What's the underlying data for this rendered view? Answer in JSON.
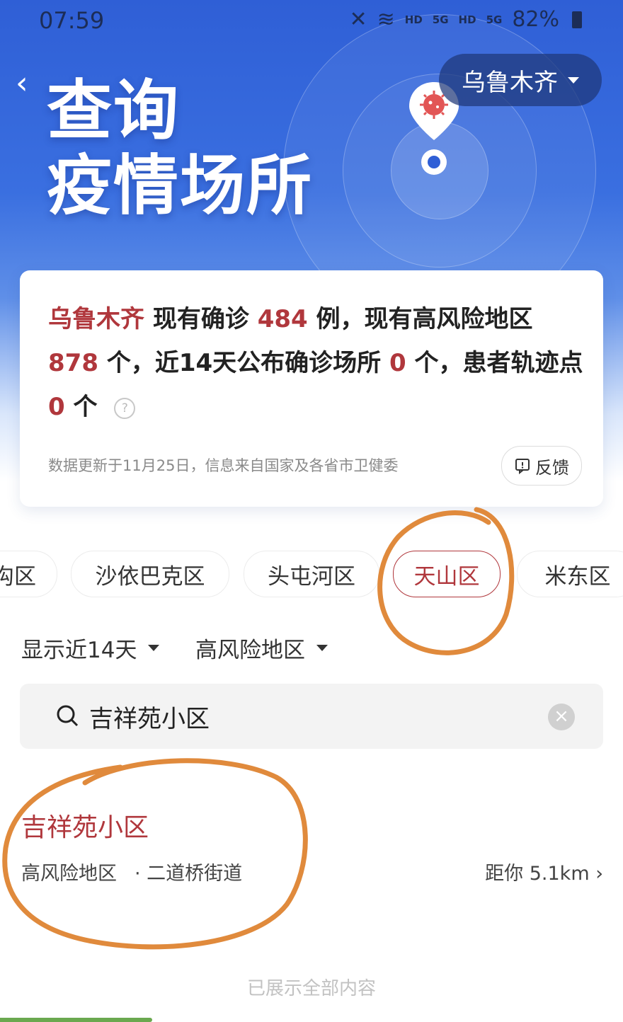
{
  "status_bar": {
    "time": "07:59",
    "battery": "82%",
    "net1": "HD",
    "net2": "5G",
    "net3": "HD",
    "net4": "5G"
  },
  "header": {
    "back_label": "‹",
    "title_line1": "查询",
    "title_line2": "疫情场所",
    "city": "乌鲁木齐"
  },
  "summary": {
    "city": "乌鲁木齐",
    "text1": "现有确诊",
    "confirmed": "484",
    "text2": "例，现有高风险地区",
    "high_risk_areas": "878",
    "text3": "个，近14天公布确诊场所",
    "places": "0",
    "text4": "个，患者轨迹点",
    "track_points": "0",
    "text5": "个",
    "help_symbol": "?",
    "update_note": "数据更新于11月25日，信息来自国家及各省市卫健委",
    "feedback_label": "反馈"
  },
  "district_tabs": [
    {
      "label": "沟区",
      "active": false
    },
    {
      "label": "沙依巴克区",
      "active": false
    },
    {
      "label": "头屯河区",
      "active": false
    },
    {
      "label": "天山区",
      "active": true
    },
    {
      "label": "米东区",
      "active": false
    }
  ],
  "filters": {
    "time_range": "显示近14天",
    "risk_level": "高风险地区"
  },
  "search": {
    "query": "吉祥苑小区",
    "clear_symbol": "×"
  },
  "results": [
    {
      "name": "吉祥苑小区",
      "risk": "高风险地区",
      "street": "· 二道桥街道",
      "distance": "距你 5.1km ›"
    }
  ],
  "footer": {
    "end_note": "已展示全部内容"
  },
  "colors": {
    "accent_red": "#b0373c",
    "hero_blue": "#2f5fd6",
    "annotation_orange": "#e08a3c"
  },
  "icons": [
    "back-icon",
    "caret-down-icon",
    "virus-pin-icon",
    "help-icon",
    "feedback-icon",
    "search-icon",
    "clear-icon",
    "chevron-right-icon"
  ]
}
